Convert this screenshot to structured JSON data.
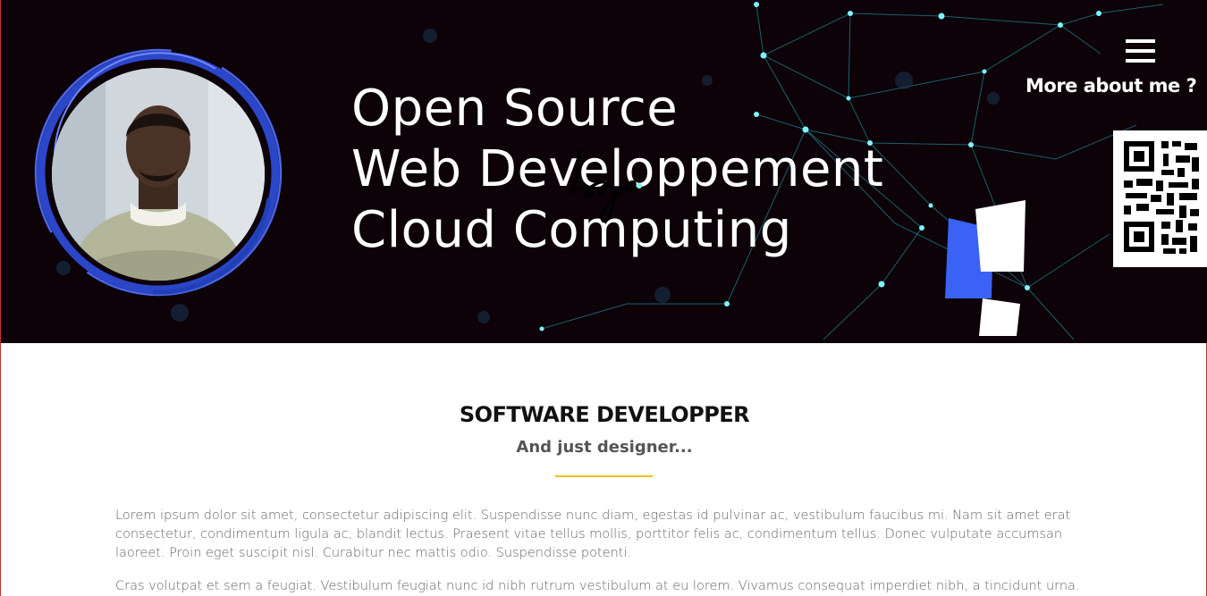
{
  "hero": {
    "headline_lines": [
      "Open Source",
      "Web Developpement",
      "Cloud Computing"
    ],
    "logo_text": "logo",
    "more_label": "More about me ?"
  },
  "icons": {
    "menu": "hamburger-menu-icon",
    "qr": "qr-code",
    "brand": "brand-mark-icon",
    "avatar": "profile-photo"
  },
  "section": {
    "title": "SOFTWARE DEVELOPPER",
    "subtitle": "And just designer...",
    "paragraphs": [
      "Lorem ipsum dolor sit amet, consectetur adipiscing elit. Suspendisse nunc diam, egestas id pulvinar ac, vestibulum faucibus mi. Nam sit amet erat consectetur, condimentum ligula ac, blandit lectus. Praesent vitae tellus mollis, porttitor felis ac, condimentum tellus. Donec vulputate accumsan laoreet. Proin eget suscipit nisl. Curabitur nec mattis odio. Suspendisse potenti.",
      "Cras volutpat et sem a feugiat. Vestibulum feugiat nunc id nibh rutrum vestibulum at eu lorem. Vivamus consequat imperdiet nibh, a tincidunt urna."
    ]
  },
  "colors": {
    "hero_bg": "#0c0208",
    "network": "#2fd3e6",
    "ring": "#3b5bdb",
    "accent_divider": "#f2c200",
    "title": "#111111",
    "subtitle": "#555555",
    "body_text": "#666666"
  }
}
